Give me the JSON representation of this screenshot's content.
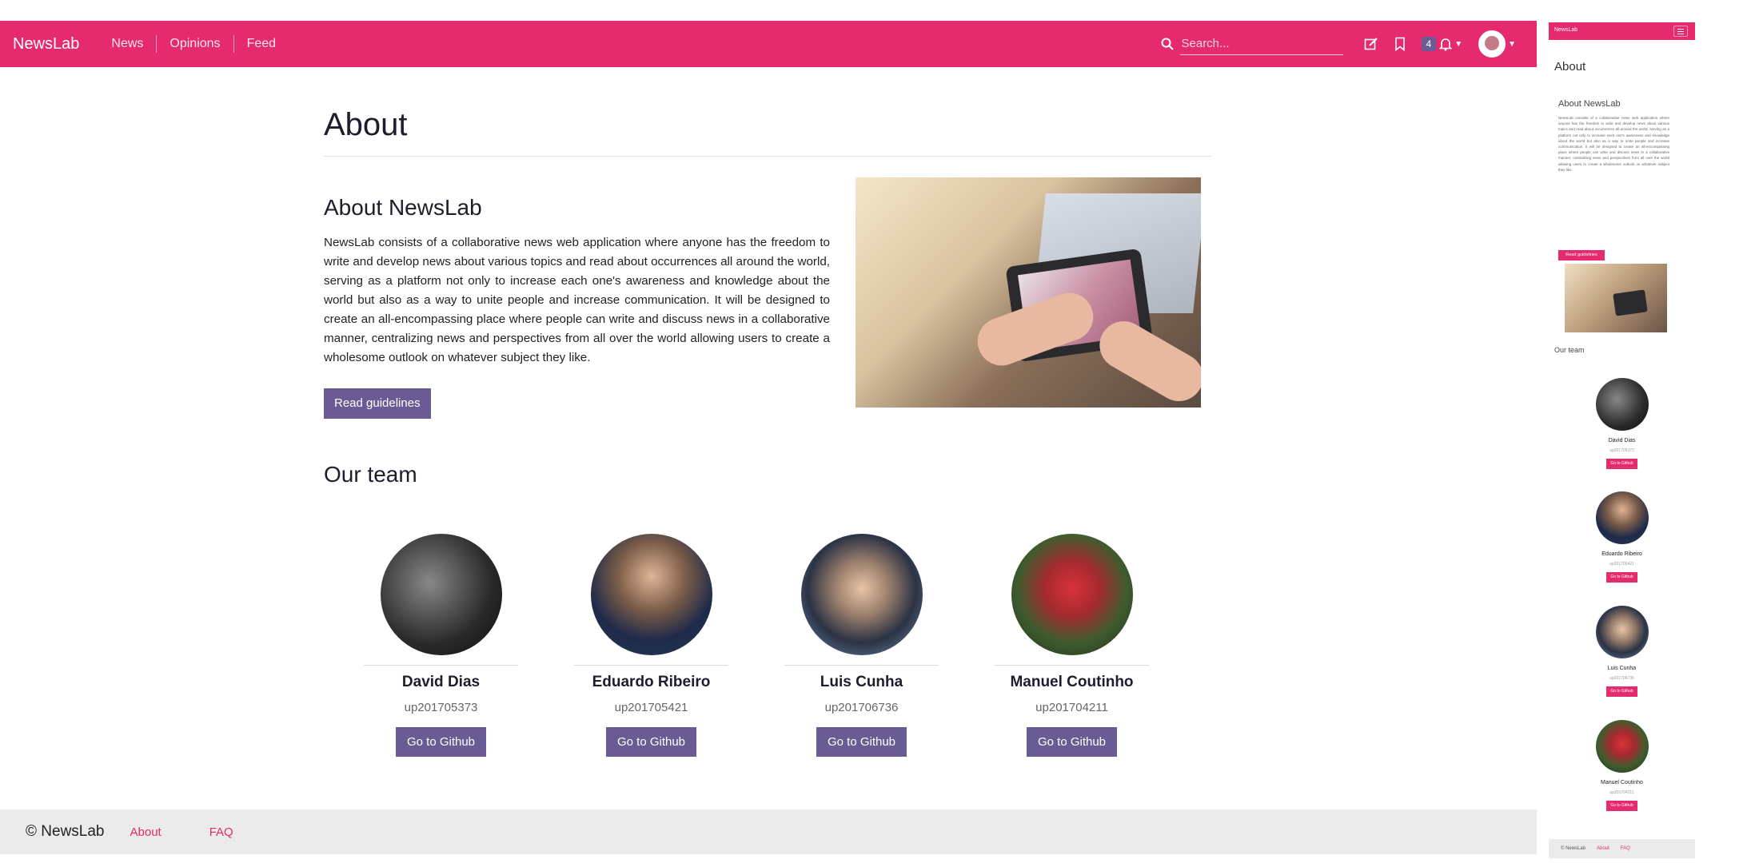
{
  "navbar": {
    "brand": "NewsLab",
    "links": [
      "News",
      "Opinions",
      "Feed"
    ],
    "search_placeholder": "Search...",
    "notification_count": "4",
    "colors": {
      "primary": "#e62a6e",
      "secondary": "#6b5b95"
    }
  },
  "page": {
    "title": "About",
    "about_heading": "About NewsLab",
    "about_text": "NewsLab consists of a collaborative news web application where anyone has the freedom to write and develop news about various topics and read about occurrences all around the world, serving as a platform not only to increase each one's awareness and knowledge about the world but also as a way to unite people and increase communication. It will be designed to create an all-encompassing place where people can write and discuss news in a collaborative manner, centralizing news and perspectives from all over the world allowing users to create a wholesome outlook on whatever subject they like.",
    "guidelines_button": "Read guidelines",
    "team_heading": "Our team",
    "team": [
      {
        "name": "David Dias",
        "id": "up201705373",
        "button": "Go to Github"
      },
      {
        "name": "Eduardo Ribeiro",
        "id": "up201705421",
        "button": "Go to Github"
      },
      {
        "name": "Luis Cunha",
        "id": "up201706736",
        "button": "Go to Github"
      },
      {
        "name": "Manuel Coutinho",
        "id": "up201704211",
        "button": "Go to Github"
      }
    ]
  },
  "footer": {
    "brand": "© NewsLab",
    "links": [
      "About",
      "FAQ"
    ]
  },
  "mobile": {
    "brand": "NewsLab",
    "title": "About",
    "about_heading": "About NewsLab",
    "guidelines_button": "Read guidelines",
    "team_heading": "Our team",
    "team": [
      {
        "name": "David Dias",
        "id": "up201705373",
        "button": "Go to Github"
      },
      {
        "name": "Eduardo Ribeiro",
        "id": "up201705421",
        "button": "Go to Github"
      },
      {
        "name": "Luis Cunha",
        "id": "up201706736",
        "button": "Go to Github"
      },
      {
        "name": "Manuel Coutinho",
        "id": "up201704211",
        "button": "Go to Github"
      }
    ],
    "footer_brand": "© NewsLab",
    "footer_links": [
      "About",
      "FAQ"
    ]
  }
}
